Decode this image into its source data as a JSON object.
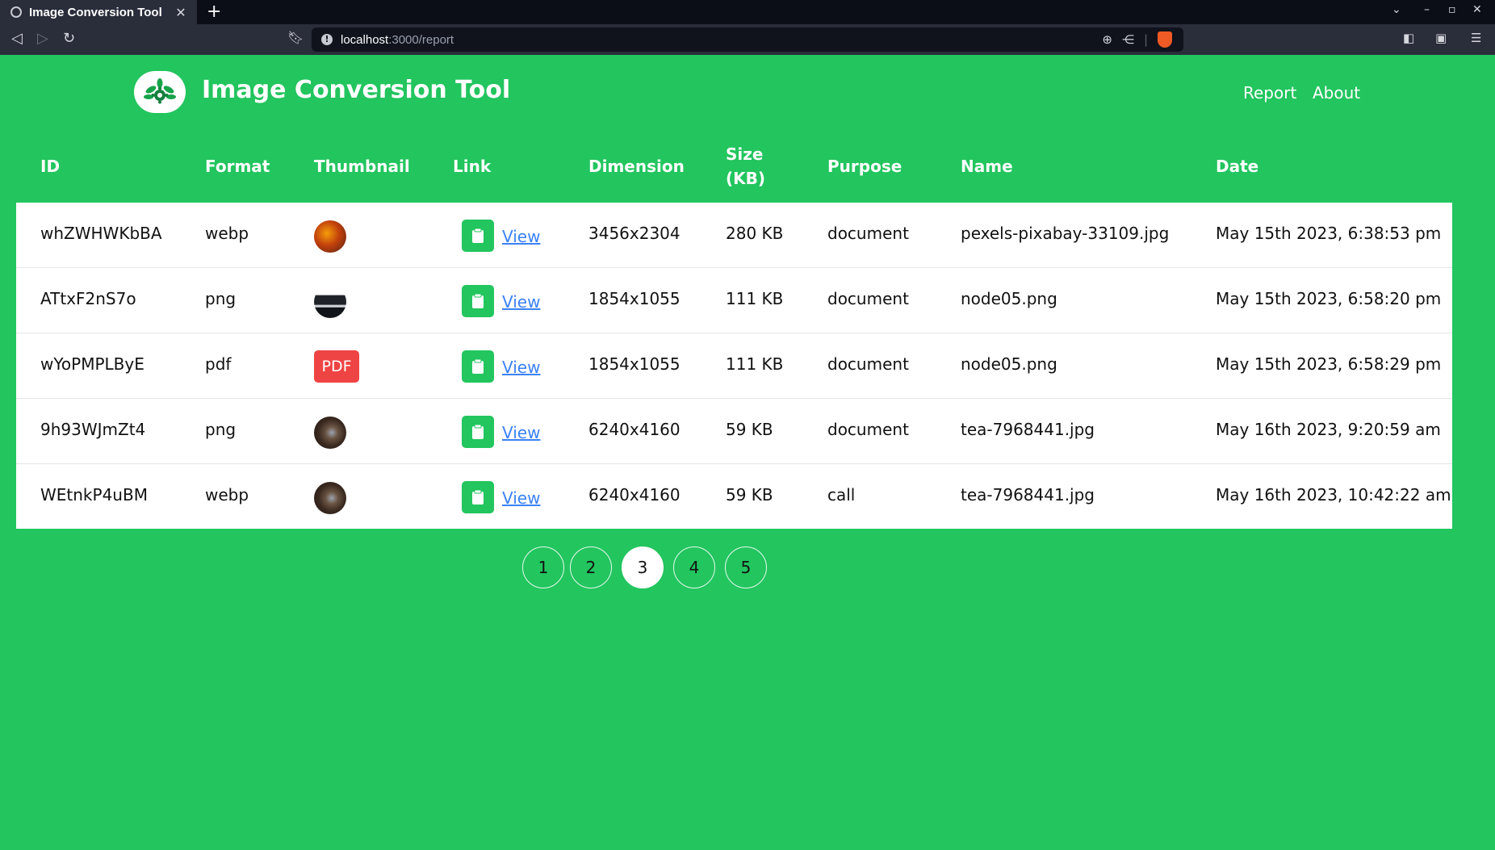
{
  "browser": {
    "tab_title": "Image Conversion Tool",
    "tab_close": "✕",
    "new_tab": "+",
    "url_host": "localhost",
    "url_path": ":3000/report"
  },
  "app": {
    "title": "Image Conversion Tool",
    "nav": [
      "Report",
      "About"
    ],
    "accent_color": "#22c55e",
    "pdf_badge_color": "#ef4444",
    "link_color": "#3b82f6"
  },
  "table": {
    "headers": {
      "id": "ID",
      "format": "Format",
      "thumbnail": "Thumbnail",
      "link": "Link",
      "dimension": "Dimension",
      "size": "Size (KB)",
      "purpose": "Purpose",
      "name": "Name",
      "date": "Date"
    },
    "rows": [
      {
        "id": "whZWHWKbBA",
        "format": "webp",
        "thumbnail": "autumn-tree-image",
        "link": "View",
        "dimension": "3456x2304",
        "size": "280 KB",
        "purpose": "document",
        "name": "pexels-pixabay-33109.jpg",
        "date": "May 15th 2023, 6:38:53 pm"
      },
      {
        "id": "ATtxF2nS7o",
        "format": "png",
        "thumbnail": "dark-screenshot-image",
        "link": "View",
        "dimension": "1854x1055",
        "size": "111 KB",
        "purpose": "document",
        "name": "node05.png",
        "date": "May 15th 2023, 6:58:20 pm"
      },
      {
        "id": "wYoPMPLByE",
        "format": "pdf",
        "thumbnail": "PDF",
        "link": "View",
        "dimension": "1854x1055",
        "size": "111 KB",
        "purpose": "document",
        "name": "node05.png",
        "date": "May 15th 2023, 6:58:29 pm"
      },
      {
        "id": "9h93WJmZt4",
        "format": "png",
        "thumbnail": "tea-image",
        "link": "View",
        "dimension": "6240x4160",
        "size": "59 KB",
        "purpose": "document",
        "name": "tea-7968441.jpg",
        "date": "May 16th 2023, 9:20:59 am"
      },
      {
        "id": "WEtnkP4uBM",
        "format": "webp",
        "thumbnail": "tea-image",
        "link": "View",
        "dimension": "6240x4160",
        "size": "59 KB",
        "purpose": "call",
        "name": "tea-7968441.jpg",
        "date": "May 16th 2023, 10:42:22 am"
      }
    ]
  },
  "pagination": {
    "pages": [
      "1",
      "2",
      "3",
      "4",
      "5"
    ],
    "current": "3"
  }
}
